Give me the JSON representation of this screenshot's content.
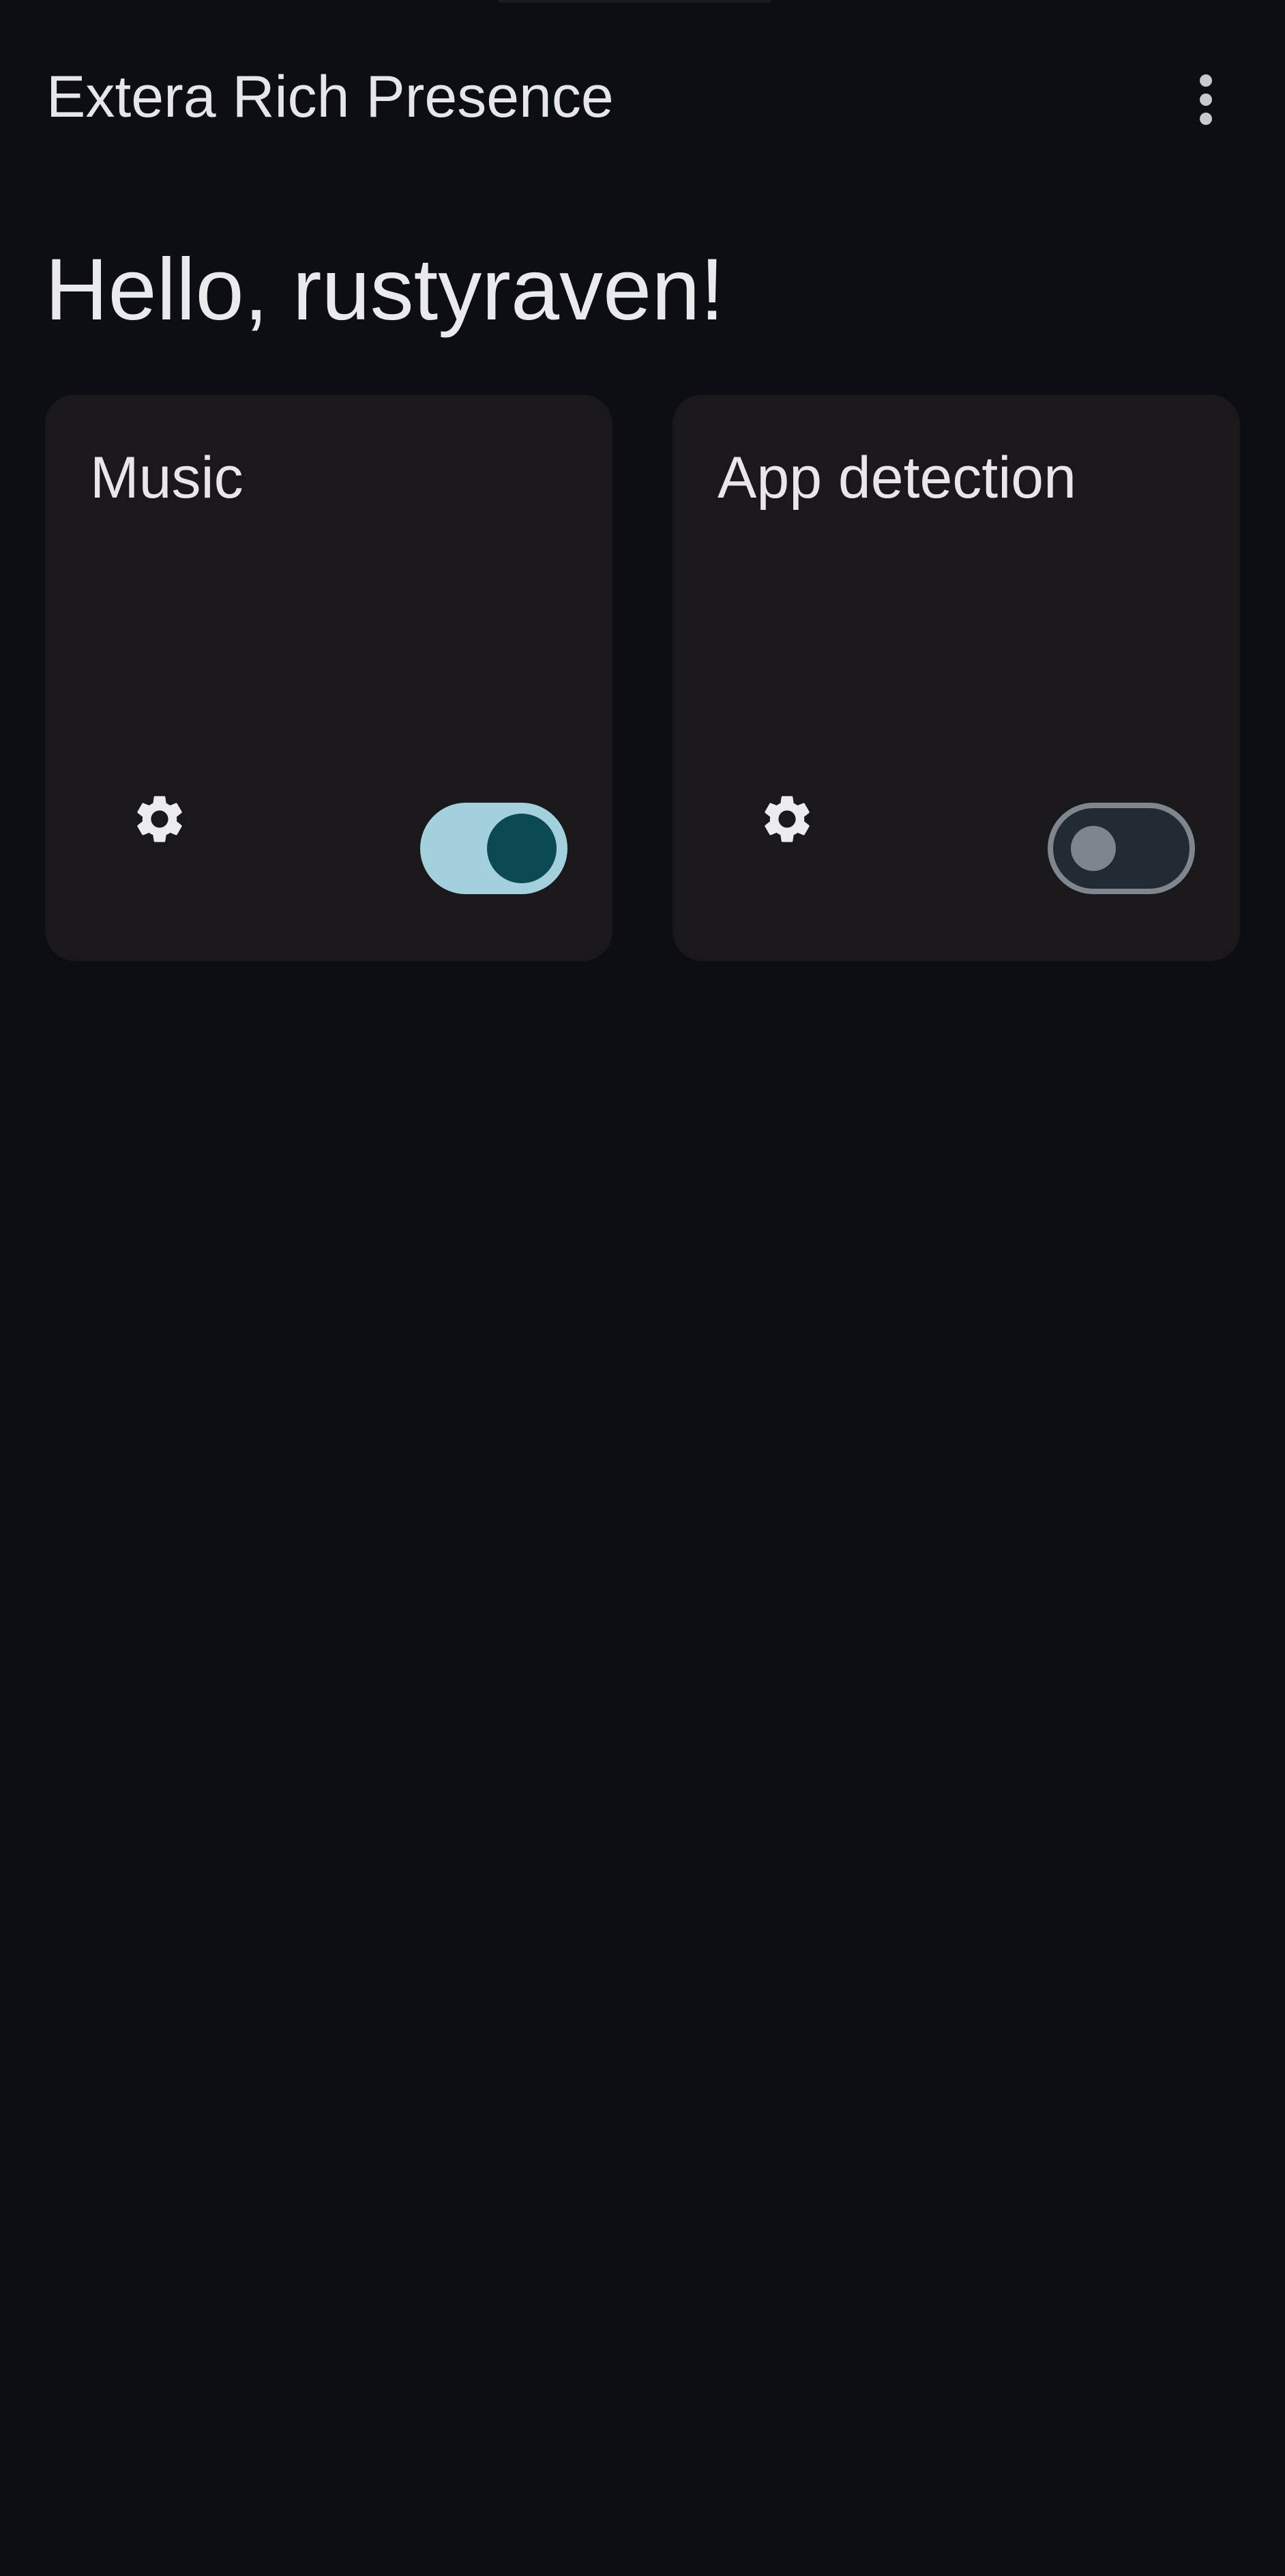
{
  "app_bar": {
    "title": "Extera Rich Presence",
    "menu_icon": "more-vert-icon"
  },
  "greeting": "Hello, rustyraven!",
  "cards": [
    {
      "title": "Music",
      "settings_icon": "gear-icon",
      "enabled": true
    },
    {
      "title": "App detection",
      "settings_icon": "gear-icon",
      "enabled": false
    }
  ],
  "colors": {
    "background": "#0b0e12",
    "card": "#1b181b",
    "text": "#e6e6ea",
    "switch_on_track": "#a2d0dc",
    "switch_on_thumb": "#0c4952",
    "switch_off_track": "#232b32",
    "switch_off_outline": "#80868d"
  }
}
